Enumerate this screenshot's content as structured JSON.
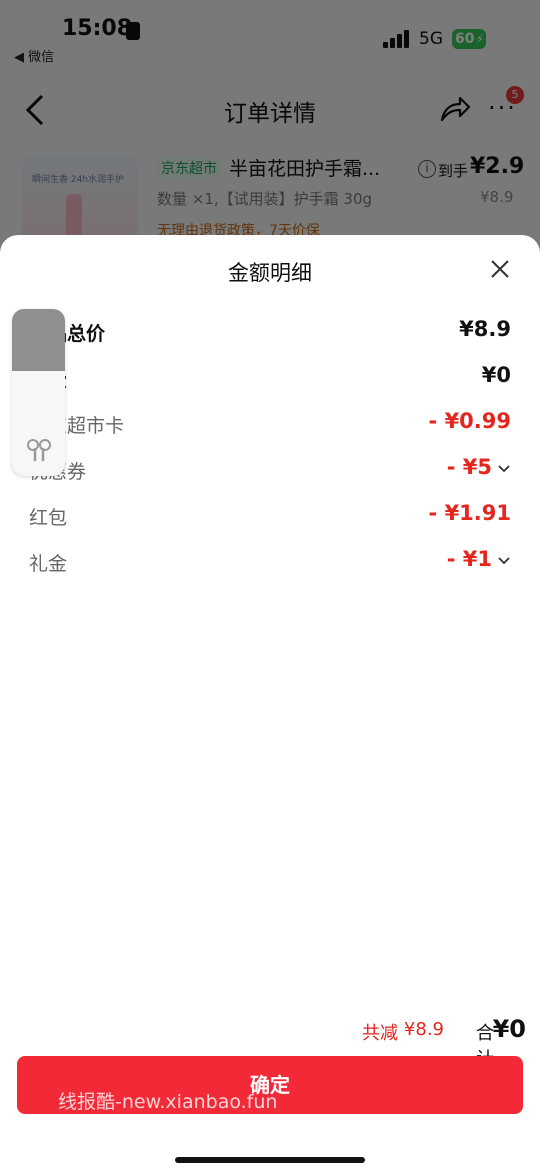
{
  "status_bar": {
    "time": "15:08",
    "back_app": "◀ 微信",
    "network": "5G",
    "battery": "60"
  },
  "nav": {
    "title": "订单详情",
    "badge": "5"
  },
  "product": {
    "tag": "京东超市",
    "name": "半亩花田护手霜...",
    "arrive_label": "到手",
    "arrive_price": "¥2.9",
    "spec": "数量 ×1,【试用装】护手霜 30g",
    "original_price": "¥8.9",
    "policy": "无理由退货政策，7天价保",
    "thumb_text": "瞬间生香  24h水润手护"
  },
  "sheet": {
    "title": "金额明细",
    "rows": [
      {
        "label": "商品总价",
        "value": "¥8.9"
      },
      {
        "label": "运费",
        "value": "¥0"
      },
      {
        "label": "京东超市卡",
        "value": "- ¥0.99"
      },
      {
        "label": "优惠券",
        "value": "- ¥5"
      },
      {
        "label": "红包",
        "value": "- ¥1.91"
      },
      {
        "label": "礼金",
        "value": "- ¥1"
      }
    ],
    "summary": {
      "reduce_label": "共减",
      "reduce_value": "¥8.9",
      "total_label": "合计",
      "total_value": "¥0"
    },
    "confirm_label": "确定",
    "watermark": "线报酷-new.xianbao.fun"
  },
  "colors": {
    "accent_red": "#e4261f",
    "button_red": "#f22a37",
    "tag_green": "#1a9c5e",
    "battery_green": "#34c759"
  },
  "earbuds_widget": {
    "level_fraction": 0.37,
    "icon": "airpods-icon"
  }
}
